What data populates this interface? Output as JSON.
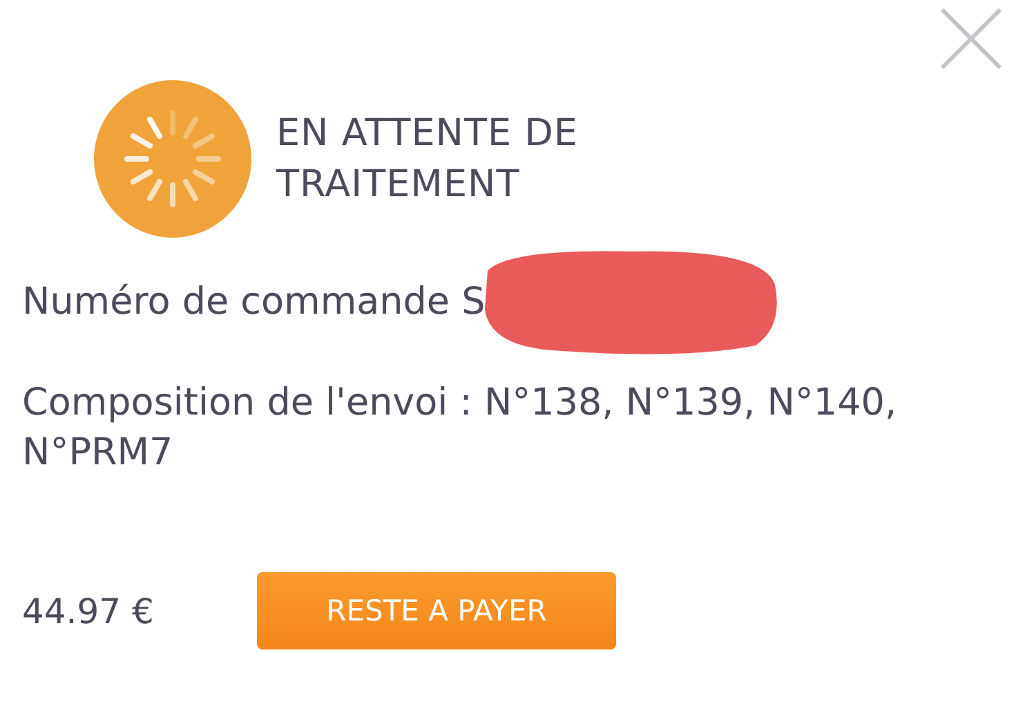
{
  "status": {
    "title": "EN ATTENTE DE TRAITEMENT"
  },
  "order": {
    "label": "Numéro de commande S"
  },
  "composition": "Composition de l'envoi : N°138, N°139, N°140, N°PRM7",
  "amount": "44.97 €",
  "pay_button": "RESTE A PAYER"
}
